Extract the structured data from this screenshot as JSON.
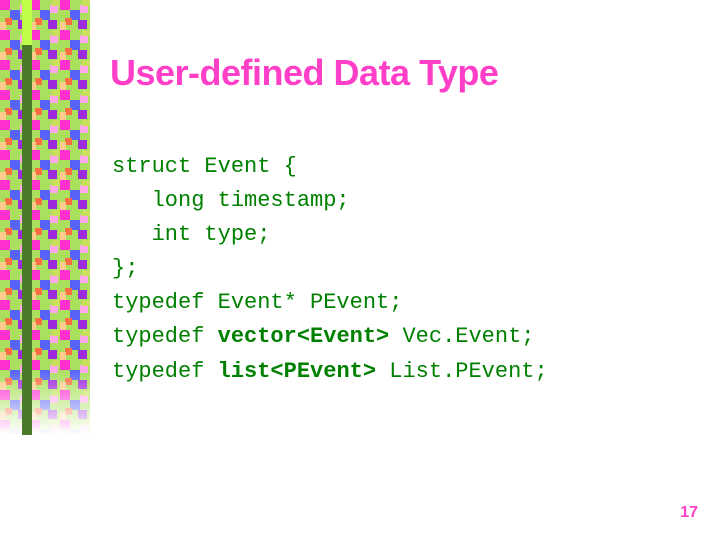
{
  "title": "User-defined Data Type",
  "code": {
    "l1": "struct Event {",
    "l2": "   long timestamp;",
    "l3": "   int type;",
    "l4": "};",
    "l5": "typedef Event* PEvent;",
    "l6a": "typedef ",
    "l6b": "vector<Event>",
    "l6c": " Vec.Event;",
    "l7a": "typedef ",
    "l7b": "list<PEvent>",
    "l7c": " List.PEvent;"
  },
  "page_number": "17"
}
